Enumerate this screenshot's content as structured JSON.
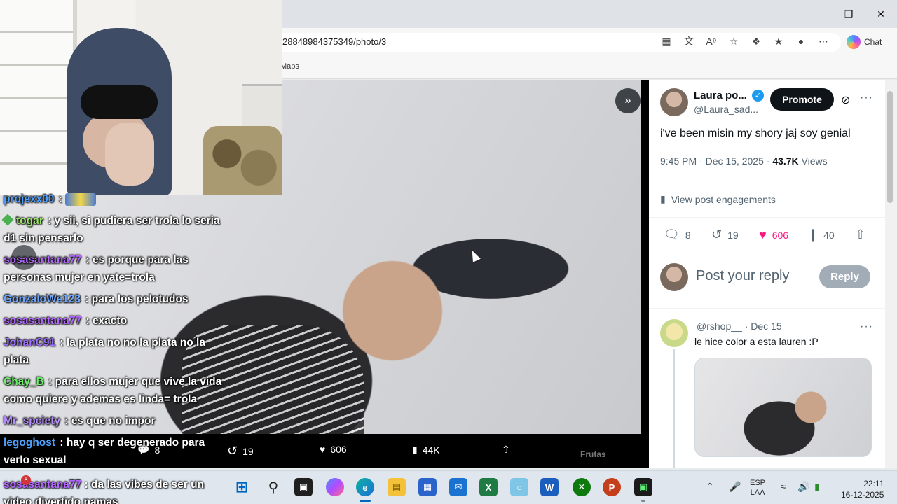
{
  "browser": {
    "url": "28848984375349/photo/3",
    "favorites": [
      "Maps"
    ],
    "chat_label": "Chat"
  },
  "viewer": {
    "actions": [
      {
        "icon": "reply-icon",
        "count": "8"
      },
      {
        "icon": "retweet-icon",
        "count": "19"
      },
      {
        "icon": "heart-icon",
        "count": "606"
      },
      {
        "icon": "views-icon",
        "count": "44K"
      }
    ],
    "edge_text": [
      "Frutas"
    ]
  },
  "stream_chat": [
    {
      "user": "projexx00",
      "user_color": "#4ea0ff",
      "text": ":",
      "emote": true
    },
    {
      "user": "togar",
      "user_color": "#9be36b",
      "text": ": y sii, si pudiera ser trola lo seria d1 sin pensarlo",
      "badge": true
    },
    {
      "user": "sosasantana77",
      "user_color": "#b366ff",
      "text": ": es porque para las personas mujer en yate=trola"
    },
    {
      "user": "GonzaloWe123",
      "user_color": "#6fa8ff",
      "text": ": para los pelotudos"
    },
    {
      "user": "sosasantana77",
      "user_color": "#b366ff",
      "text": ": exacto"
    },
    {
      "user": "JohanC91",
      "user_color": "#a070ff",
      "text": ": la plata no no la plata no la plata"
    },
    {
      "user": "Chay_B",
      "user_color": "#6cf06c",
      "text": ": para ellos mujer que vive la vida como quiere y ademas es linda= trola"
    },
    {
      "user": "Mr_spciety",
      "user_color": "#b58cff",
      "text": ": es que no impor"
    },
    {
      "user": "legoghost",
      "user_color": "#4ea0ff",
      "text": ": hay q ser degenerado para verlo sexual"
    }
  ],
  "stream_chat_bottom": {
    "user": "sosasantana77",
    "user_color": "#b366ff",
    "text": ": da las vibes de ser un video divertido namas",
    "badge_count": "8"
  },
  "post": {
    "author_name": "Laura po...",
    "author_handle": "@Laura_sad...",
    "promote_label": "Promote",
    "text": "i've been misin my shory jaj soy genial",
    "time": "9:45 PM · Dec 15, 2025 · ",
    "views_count": "43.7K",
    "views_label": " Views",
    "engagements_label": "View post engagements",
    "stats": {
      "replies": "8",
      "reposts": "19",
      "likes": "606",
      "bookmarks": "40"
    },
    "reply_placeholder": "Post your reply",
    "reply_button": "Reply"
  },
  "reply": {
    "handle": "@rshop__",
    "date": " · Dec 15",
    "text": "le hice color a esta lauren :P"
  },
  "taskbar": {
    "language": "ESP",
    "region": "LAA",
    "time": "22:11",
    "date": "16-12-2025"
  },
  "colors": {
    "like": "#f91880",
    "brand_dark": "#0f1419",
    "verified": "#1d9bf0"
  }
}
